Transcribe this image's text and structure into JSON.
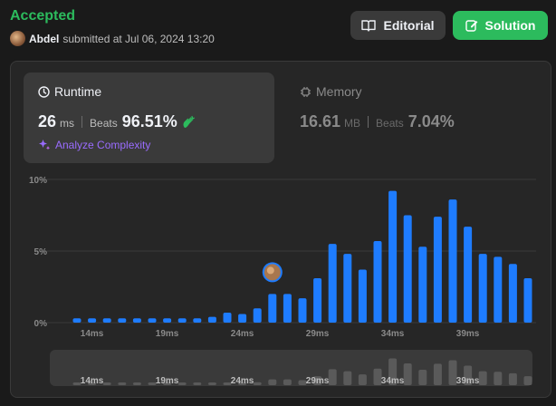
{
  "header": {
    "status": "Accepted",
    "user": "Abdel",
    "submitted_text": "submitted at Jul 06, 2024 13:20"
  },
  "buttons": {
    "editorial": "Editorial",
    "solution": "Solution"
  },
  "runtime": {
    "title": "Runtime",
    "value": "26",
    "unit": "ms",
    "beats_label": "Beats",
    "beats_value": "96.51%",
    "analyze": "Analyze Complexity"
  },
  "memory": {
    "title": "Memory",
    "value": "16.61",
    "unit": "MB",
    "beats_label": "Beats",
    "beats_value": "7.04%"
  },
  "colors": {
    "accent_green": "#2cbb5d",
    "bar_blue": "#1e7cff",
    "analyze_purple": "#9a6cff"
  },
  "chart_data": {
    "type": "bar",
    "y_ticks": [
      "10%",
      "5%",
      "0%"
    ],
    "ylim": [
      0,
      10
    ],
    "x": [
      13,
      14,
      15,
      16,
      17,
      18,
      19,
      20,
      21,
      22,
      23,
      24,
      25,
      26,
      27,
      28,
      29,
      30,
      31,
      32,
      33,
      34,
      35,
      36,
      37,
      38,
      39,
      40,
      41,
      42,
      43
    ],
    "x_tick_labels": [
      "14ms",
      "19ms",
      "24ms",
      "29ms",
      "34ms",
      "39ms"
    ],
    "values": [
      0.3,
      0.3,
      0.3,
      0.3,
      0.3,
      0.3,
      0.3,
      0.3,
      0.3,
      0.4,
      0.7,
      0.6,
      1.0,
      2.0,
      2.0,
      1.7,
      3.1,
      5.5,
      4.8,
      3.7,
      5.7,
      9.2,
      7.5,
      5.3,
      7.4,
      8.6,
      6.7,
      4.8,
      4.6,
      4.1,
      3.1
    ],
    "highlight_x": 26
  }
}
